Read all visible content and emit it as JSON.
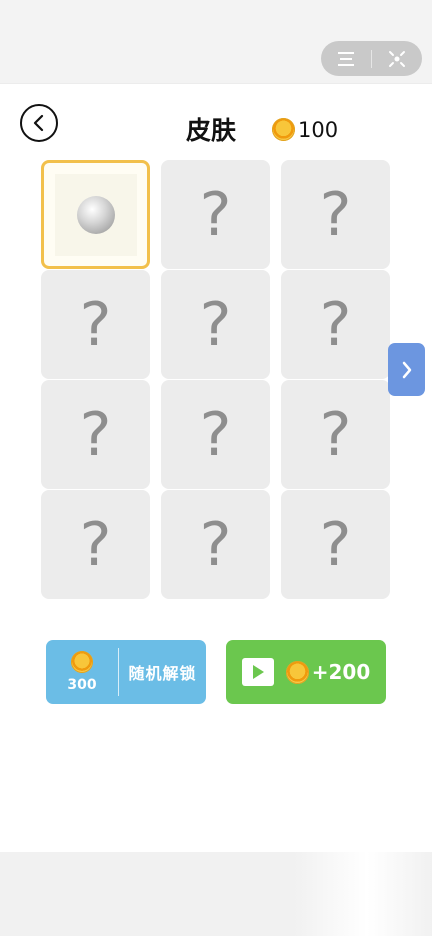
{
  "header": {
    "title": "皮肤",
    "coins": "100"
  },
  "grid": {
    "cells": [
      {
        "state": "selected",
        "label": ""
      },
      {
        "state": "locked",
        "label": "?"
      },
      {
        "state": "locked",
        "label": "?"
      },
      {
        "state": "locked",
        "label": "?"
      },
      {
        "state": "locked",
        "label": "?"
      },
      {
        "state": "locked",
        "label": "?"
      },
      {
        "state": "locked",
        "label": "?"
      },
      {
        "state": "locked",
        "label": "?"
      },
      {
        "state": "locked",
        "label": "?"
      },
      {
        "state": "locked",
        "label": "?"
      },
      {
        "state": "locked",
        "label": "?"
      },
      {
        "state": "locked",
        "label": "?"
      }
    ]
  },
  "actions": {
    "unlock_price": "300",
    "unlock_label": "随机解锁",
    "video_reward": "+200"
  },
  "colors": {
    "accent_blue": "#6bbde6",
    "accent_green": "#6bc74e",
    "selected_border": "#f2c04c",
    "next_button": "#6c96e0"
  },
  "icons": [
    "menu-icon",
    "close-icon",
    "back-arrow-icon",
    "coin-icon",
    "chevron-right-icon",
    "play-icon",
    "skin-ball-icon"
  ]
}
